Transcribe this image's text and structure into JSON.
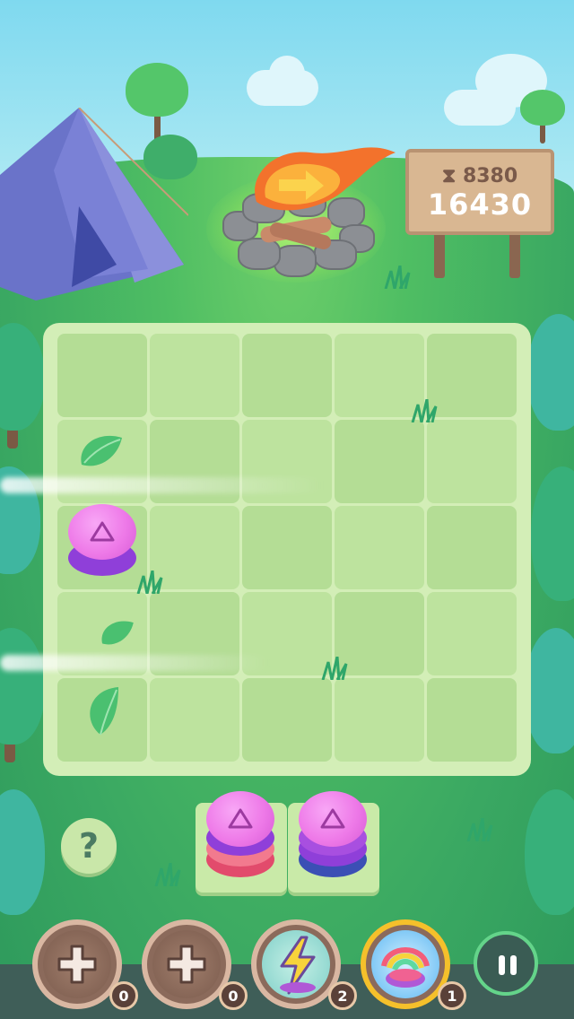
{
  "scoreboard": {
    "best_score": "8380",
    "current_score": "16430",
    "trophy_icon": "trophy-icon"
  },
  "board": {
    "rows": 5,
    "cols": 5,
    "pieces": [
      {
        "row": 2,
        "col": 0,
        "color": "purple",
        "symbol": "triangle-up"
      }
    ]
  },
  "tray": [
    {
      "top": "pink",
      "layers": [
        "#e24b6c",
        "#f27a8e"
      ]
    },
    {
      "top": "pink",
      "layers": [
        "#3b4fb5",
        "#8f3fd9"
      ]
    }
  ],
  "help_button": {
    "label": "?"
  },
  "boosters": [
    {
      "name": "add-piece",
      "count": "0",
      "icon": "plus-icon"
    },
    {
      "name": "add-piece-2",
      "count": "0",
      "icon": "plus-icon"
    },
    {
      "name": "lightning-clear",
      "count": "2",
      "icon": "lightning-icon"
    },
    {
      "name": "rainbow-blast",
      "count": "1",
      "icon": "rainbow-icon"
    }
  ],
  "colors": {
    "board": "#d3eeb7",
    "grass": "#3fae6a",
    "chip_top": "#ee7ae8",
    "bar": "#3f5e58"
  }
}
